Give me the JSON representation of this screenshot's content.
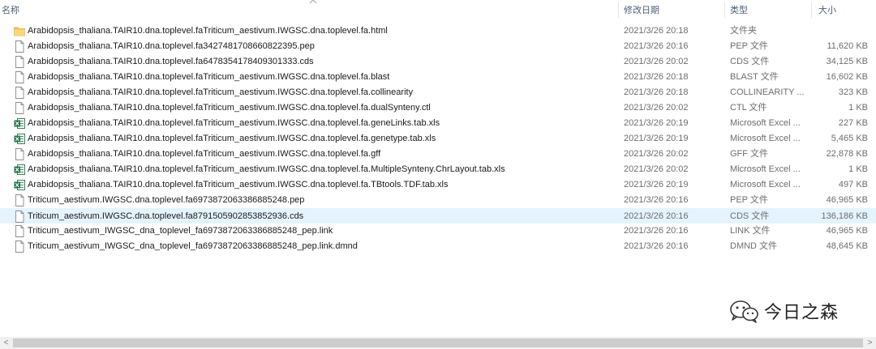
{
  "columns": {
    "name": "名称",
    "date": "修改日期",
    "type": "类型",
    "size": "大小"
  },
  "files": [
    {
      "name": "Arabidopsis_thaliana.TAIR10.dna.toplevel.faTriticum_aestivum.IWGSC.dna.toplevel.fa.html",
      "date": "2021/3/26 20:18",
      "type": "文件夹",
      "size": "",
      "icon": "folder-icon"
    },
    {
      "name": "Arabidopsis_thaliana.TAIR10.dna.toplevel.fa3427481708660822395.pep",
      "date": "2021/3/26 20:16",
      "type": "PEP 文件",
      "size": "11,620 KB",
      "icon": "file-icon"
    },
    {
      "name": "Arabidopsis_thaliana.TAIR10.dna.toplevel.fa6478354178409301333.cds",
      "date": "2021/3/26 20:02",
      "type": "CDS 文件",
      "size": "34,125 KB",
      "icon": "file-icon"
    },
    {
      "name": "Arabidopsis_thaliana.TAIR10.dna.toplevel.faTriticum_aestivum.IWGSC.dna.toplevel.fa.blast",
      "date": "2021/3/26 20:18",
      "type": "BLAST 文件",
      "size": "16,602 KB",
      "icon": "file-icon"
    },
    {
      "name": "Arabidopsis_thaliana.TAIR10.dna.toplevel.faTriticum_aestivum.IWGSC.dna.toplevel.fa.collinearity",
      "date": "2021/3/26 20:18",
      "type": "COLLINEARITY ...",
      "size": "323 KB",
      "icon": "file-icon"
    },
    {
      "name": "Arabidopsis_thaliana.TAIR10.dna.toplevel.faTriticum_aestivum.IWGSC.dna.toplevel.fa.dualSynteny.ctl",
      "date": "2021/3/26 20:02",
      "type": "CTL 文件",
      "size": "1 KB",
      "icon": "file-icon"
    },
    {
      "name": "Arabidopsis_thaliana.TAIR10.dna.toplevel.faTriticum_aestivum.IWGSC.dna.toplevel.fa.geneLinks.tab.xls",
      "date": "2021/3/26 20:19",
      "type": "Microsoft Excel ...",
      "size": "227 KB",
      "icon": "excel-icon"
    },
    {
      "name": "Arabidopsis_thaliana.TAIR10.dna.toplevel.faTriticum_aestivum.IWGSC.dna.toplevel.fa.genetype.tab.xls",
      "date": "2021/3/26 20:19",
      "type": "Microsoft Excel ...",
      "size": "5,465 KB",
      "icon": "excel-icon"
    },
    {
      "name": "Arabidopsis_thaliana.TAIR10.dna.toplevel.faTriticum_aestivum.IWGSC.dna.toplevel.fa.gff",
      "date": "2021/3/26 20:02",
      "type": "GFF 文件",
      "size": "22,878 KB",
      "icon": "file-icon"
    },
    {
      "name": "Arabidopsis_thaliana.TAIR10.dna.toplevel.faTriticum_aestivum.IWGSC.dna.toplevel.fa.MultipleSynteny.ChrLayout.tab.xls",
      "date": "2021/3/26 20:02",
      "type": "Microsoft Excel ...",
      "size": "1 KB",
      "icon": "excel-icon"
    },
    {
      "name": "Arabidopsis_thaliana.TAIR10.dna.toplevel.faTriticum_aestivum.IWGSC.dna.toplevel.fa.TBtools.TDF.tab.xls",
      "date": "2021/3/26 20:19",
      "type": "Microsoft Excel ...",
      "size": "497 KB",
      "icon": "excel-icon"
    },
    {
      "name": "Triticum_aestivum.IWGSC.dna.toplevel.fa6973872063386885248.pep",
      "date": "2021/3/26 20:16",
      "type": "PEP 文件",
      "size": "46,965 KB",
      "icon": "file-icon"
    },
    {
      "name": "Triticum_aestivum.IWGSC.dna.toplevel.fa8791505902853852936.cds",
      "date": "2021/3/26 20:16",
      "type": "CDS 文件",
      "size": "136,186 KB",
      "icon": "file-icon",
      "selected": true
    },
    {
      "name": "Triticum_aestivum_IWGSC_dna_toplevel_fa6973872063386885248_pep.link",
      "date": "2021/3/26 20:16",
      "type": "LINK 文件",
      "size": "46,965 KB",
      "icon": "file-icon"
    },
    {
      "name": "Triticum_aestivum_IWGSC_dna_toplevel_fa6973872063386885248_pep.link.dmnd",
      "date": "2021/3/26 20:16",
      "type": "DMND 文件",
      "size": "48,645 KB",
      "icon": "file-icon"
    }
  ],
  "watermark": {
    "text": "今日之森",
    "icon": "wechat-icon"
  },
  "scrollbar": {
    "left_arrow": "<",
    "right_arrow": ">"
  },
  "colors": {
    "selected_row": "#e5f3ff",
    "folder": "#f5c85c",
    "excel": "#1f7346"
  }
}
